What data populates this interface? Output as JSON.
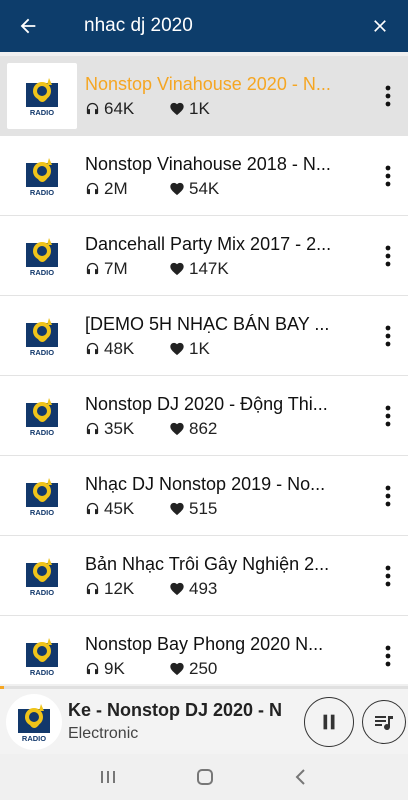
{
  "search": {
    "query": "nhac dj 2020"
  },
  "stations": [
    {
      "name": "Nonstop Vinahouse 2020 - N...",
      "listens": "64K",
      "likes": "1K",
      "active": true
    },
    {
      "name": "Nonstop Vinahouse 2018 - N...",
      "listens": "2M",
      "likes": "54K"
    },
    {
      "name": "Dancehall Party Mix 2017 - 2...",
      "listens": "7M",
      "likes": "147K"
    },
    {
      "name": "[DEMO 5H NHẠC BÁN BAY ...",
      "listens": "48K",
      "likes": "1K"
    },
    {
      "name": "Nonstop DJ 2020 - Động Thi...",
      "listens": "35K",
      "likes": "862"
    },
    {
      "name": "Nhạc DJ Nonstop 2019 - No...",
      "listens": "45K",
      "likes": "515"
    },
    {
      "name": "Bản Nhạc Trôi Gây Nghiện 2...",
      "listens": "12K",
      "likes": "493"
    },
    {
      "name": "Nonstop Bay Phong 2020 N...",
      "listens": "9K",
      "likes": "250"
    }
  ],
  "logo": {
    "text": "RADIO"
  },
  "player": {
    "title": "Ke - Nonstop DJ 2020 - N",
    "genre": "Electronic",
    "progress": 0.01
  },
  "colors": {
    "appbar": "#0d3d6b",
    "accent": "#f5a623"
  },
  "icons": {
    "back": "arrow-left-icon",
    "close": "close-icon",
    "more": "more-vert-icon",
    "listens": "headphones-icon",
    "likes": "heart-icon",
    "pause": "pause-icon",
    "queue": "queue-music-icon"
  }
}
